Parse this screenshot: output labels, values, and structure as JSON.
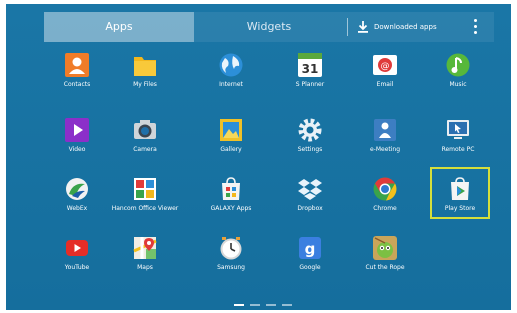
{
  "tabs": {
    "apps": "Apps",
    "widgets": "Widgets"
  },
  "download_label": "Downloaded apps",
  "apps": [
    {
      "name": "contacts",
      "label": "Contacts"
    },
    {
      "name": "my-files",
      "label": "My Files"
    },
    {
      "name": "internet",
      "label": "Internet"
    },
    {
      "name": "s-planner",
      "label": "S Planner",
      "badge": "31"
    },
    {
      "name": "email",
      "label": "Email"
    },
    {
      "name": "music",
      "label": "Music"
    },
    {
      "name": "video",
      "label": "Video"
    },
    {
      "name": "camera",
      "label": "Camera"
    },
    {
      "name": "gallery",
      "label": "Gallery"
    },
    {
      "name": "settings",
      "label": "Settings"
    },
    {
      "name": "e-meeting",
      "label": "e-Meeting"
    },
    {
      "name": "remote-pc",
      "label": "Remote PC"
    },
    {
      "name": "webex",
      "label": "WebEx"
    },
    {
      "name": "hancom-office-viewer",
      "label": "Hancom Office Viewer"
    },
    {
      "name": "galaxy-apps",
      "label": "GALAXY Apps"
    },
    {
      "name": "dropbox",
      "label": "Dropbox"
    },
    {
      "name": "chrome",
      "label": "Chrome"
    },
    {
      "name": "play-store",
      "label": "Play Store"
    },
    {
      "name": "youtube",
      "label": "YouTube"
    },
    {
      "name": "maps",
      "label": "Maps"
    },
    {
      "name": "samsung",
      "label": "Samsung"
    },
    {
      "name": "google",
      "label": "Google"
    },
    {
      "name": "cut-the-rope",
      "label": "Cut the Rope"
    }
  ]
}
